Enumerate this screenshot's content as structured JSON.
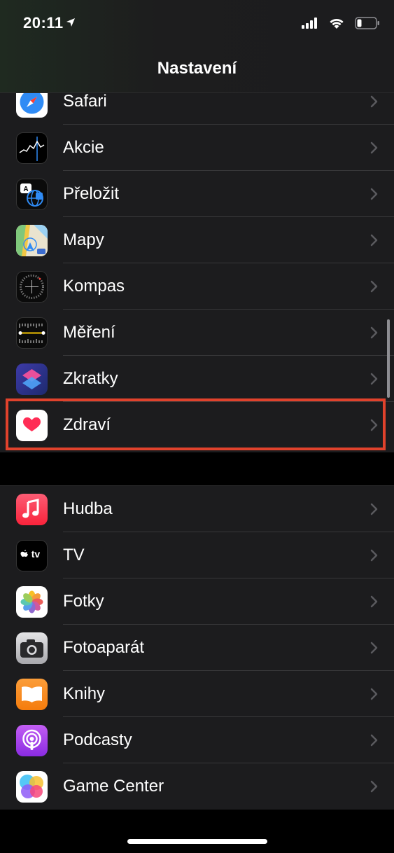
{
  "status": {
    "time": "20:11"
  },
  "nav": {
    "title": "Nastavení"
  },
  "group1": [
    {
      "id": "safari",
      "label": "Safari"
    },
    {
      "id": "akcie",
      "label": "Akcie"
    },
    {
      "id": "prelozit",
      "label": "Přeložit"
    },
    {
      "id": "mapy",
      "label": "Mapy"
    },
    {
      "id": "kompas",
      "label": "Kompas"
    },
    {
      "id": "mereni",
      "label": "Měření"
    },
    {
      "id": "zkratky",
      "label": "Zkratky"
    },
    {
      "id": "zdravi",
      "label": "Zdraví"
    }
  ],
  "group2": [
    {
      "id": "hudba",
      "label": "Hudba"
    },
    {
      "id": "tv",
      "label": "TV"
    },
    {
      "id": "fotky",
      "label": "Fotky"
    },
    {
      "id": "fotoaparat",
      "label": "Fotoaparát"
    },
    {
      "id": "knihy",
      "label": "Knihy"
    },
    {
      "id": "podcasty",
      "label": "Podcasty"
    },
    {
      "id": "game-center",
      "label": "Game Center"
    }
  ],
  "icons": {
    "safari": "safari-compass-icon",
    "akcie": "stocks-chart-icon",
    "prelozit": "translate-icon",
    "mapy": "maps-icon",
    "kompas": "compass-icon",
    "mereni": "measure-ruler-icon",
    "zkratky": "shortcuts-icon",
    "zdravi": "health-heart-icon",
    "hudba": "music-note-icon",
    "tv": "apple-tv-icon",
    "fotky": "photos-flower-icon",
    "fotoaparat": "camera-icon",
    "knihy": "books-icon",
    "podcasty": "podcasts-icon",
    "game-center": "game-center-icon"
  },
  "colors": {
    "highlight": "#e0422c",
    "background": "#000000",
    "cell": "#1c1c1e",
    "separator": "#38383a"
  }
}
